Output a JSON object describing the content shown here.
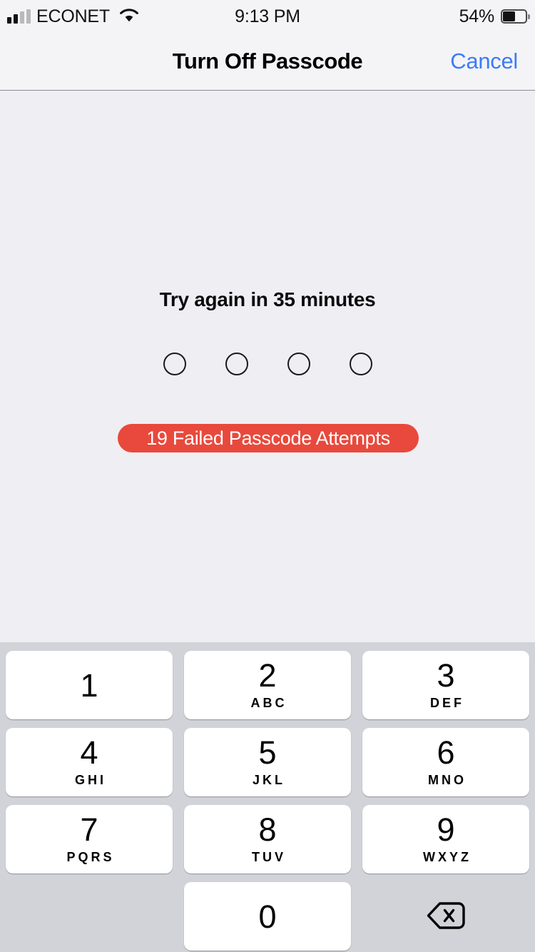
{
  "status_bar": {
    "carrier": "ECONET",
    "signal_icon": "cellular-signal-icon",
    "signal_bars_total": 4,
    "signal_bars_filled": 2,
    "wifi_icon": "wifi-icon",
    "time": "9:13 PM",
    "battery_percent": "54%",
    "battery_level": 54,
    "battery_icon": "battery-icon"
  },
  "nav_bar": {
    "title": "Turn Off Passcode",
    "cancel_label": "Cancel",
    "accent_color": "#3d7bf7"
  },
  "content": {
    "try_again_text": "Try again in 35 minutes",
    "passcode_length": 4,
    "passcode_filled": 0,
    "failed_attempts_badge": "19 Failed Passcode Attempts",
    "badge_color": "#e8493c"
  },
  "keypad": {
    "keys": [
      {
        "digit": "1",
        "letters": ""
      },
      {
        "digit": "2",
        "letters": "ABC"
      },
      {
        "digit": "3",
        "letters": "DEF"
      },
      {
        "digit": "4",
        "letters": "GHI"
      },
      {
        "digit": "5",
        "letters": "JKL"
      },
      {
        "digit": "6",
        "letters": "MNO"
      },
      {
        "digit": "7",
        "letters": "PQRS"
      },
      {
        "digit": "8",
        "letters": "TUV"
      },
      {
        "digit": "9",
        "letters": "WXYZ"
      },
      {
        "digit": "0",
        "letters": ""
      }
    ],
    "delete_icon": "backspace-delete-icon"
  }
}
